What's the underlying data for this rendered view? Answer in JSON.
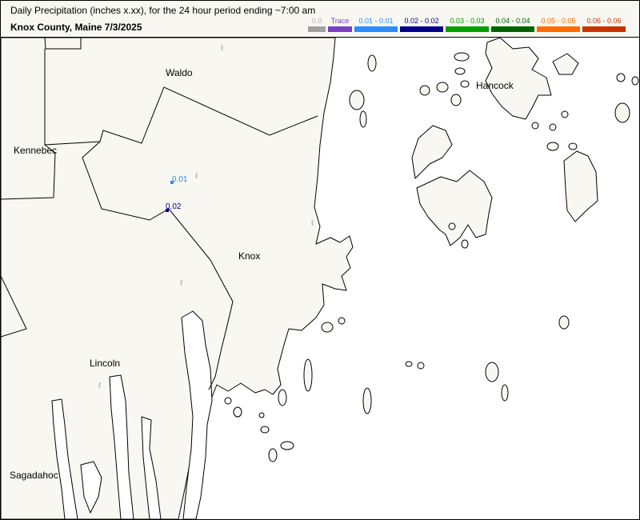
{
  "header": {
    "title": "Daily Precipitation (inches  x.xx),  for the 24 hour period ending ~7:00 am",
    "subtitle": "Knox County, Maine  7/3/2025"
  },
  "legend": [
    {
      "label": "0.0",
      "color": "#a0a0a0",
      "text_color": "#b0b0b0"
    },
    {
      "label": "Trace",
      "color": "#7b3fc4",
      "text_color": "#7b3fc4"
    },
    {
      "label": "0.01 - 0.01",
      "color": "#2a8cff",
      "text_color": "#2a8cff"
    },
    {
      "label": "0.02 - 0.02",
      "color": "#00008b",
      "text_color": "#00008b"
    },
    {
      "label": "0.03 - 0.03",
      "color": "#00a000",
      "text_color": "#00a000"
    },
    {
      "label": "0.04 - 0.04",
      "color": "#006400",
      "text_color": "#006400"
    },
    {
      "label": "0.05 - 0.05",
      "color": "#ff6a00",
      "text_color": "#ff6a00"
    },
    {
      "label": "0.06 - 0.06",
      "color": "#c83200",
      "text_color": "#c83200"
    }
  ],
  "map": {
    "counties": {
      "waldo": "Waldo",
      "kennebec": "Kennebec",
      "hancock": "Hancock",
      "knox": "Knox",
      "lincoln": "Lincoln",
      "sagadahoc": "Sagadahoc"
    },
    "stations": {
      "s1": "0.01",
      "s2": "0.02"
    },
    "colors": {
      "land": "#f8f7f2",
      "water": "#ffffff",
      "boundary": "#000000"
    }
  }
}
